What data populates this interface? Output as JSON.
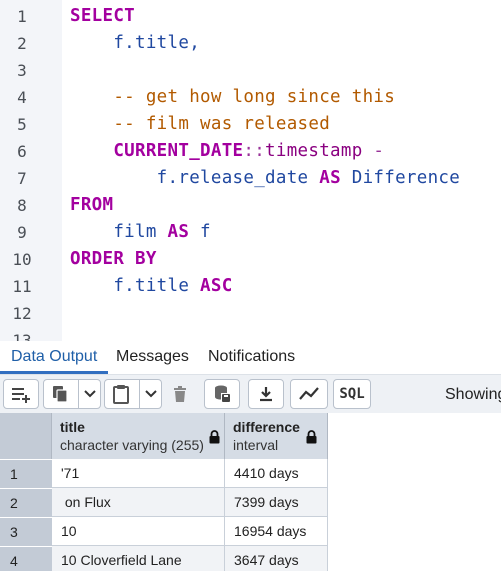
{
  "editor": {
    "lines": [
      {
        "n": "1",
        "tokens": [
          {
            "t": "SELECT",
            "c": "kw"
          }
        ]
      },
      {
        "n": "2",
        "tokens": [
          {
            "t": "    f.title,",
            "c": "id"
          }
        ]
      },
      {
        "n": "3",
        "tokens": []
      },
      {
        "n": "4",
        "tokens": [
          {
            "t": "    -- get how long since this",
            "c": "cm"
          }
        ]
      },
      {
        "n": "5",
        "tokens": [
          {
            "t": "    -- film was released",
            "c": "cm"
          }
        ]
      },
      {
        "n": "6",
        "tokens": [
          {
            "t": "    ",
            "c": "id"
          },
          {
            "t": "CURRENT_DATE",
            "c": "kw"
          },
          {
            "t": "::",
            "c": "op"
          },
          {
            "t": "timestamp",
            "c": "fn"
          },
          {
            "t": " -",
            "c": "op"
          }
        ]
      },
      {
        "n": "7",
        "tokens": [
          {
            "t": "        f.release_date ",
            "c": "id"
          },
          {
            "t": "AS",
            "c": "kw"
          },
          {
            "t": " Difference",
            "c": "id"
          }
        ]
      },
      {
        "n": "8",
        "tokens": [
          {
            "t": "FROM",
            "c": "kw"
          }
        ]
      },
      {
        "n": "9",
        "tokens": [
          {
            "t": "    film ",
            "c": "id"
          },
          {
            "t": "AS",
            "c": "kw"
          },
          {
            "t": " f",
            "c": "id"
          }
        ]
      },
      {
        "n": "10",
        "tokens": [
          {
            "t": "ORDER BY",
            "c": "kw"
          }
        ]
      },
      {
        "n": "11",
        "tokens": [
          {
            "t": "    f.title ",
            "c": "id"
          },
          {
            "t": "ASC",
            "c": "kw"
          }
        ]
      },
      {
        "n": "12",
        "tokens": []
      },
      {
        "n": "13",
        "tokens": []
      }
    ]
  },
  "tabs": {
    "data_output": "Data Output",
    "messages": "Messages",
    "notifications": "Notifications"
  },
  "toolbar": {
    "icons": [
      "add-row-icon",
      "copy-icon",
      "dropdown-chevron-icon",
      "paste-icon",
      "dropdown-chevron-icon",
      "delete-icon",
      "save-data-icon",
      "download-icon",
      "graph-visualiser-icon"
    ],
    "sql_label": "SQL",
    "showing_label": "Showing"
  },
  "grid": {
    "columns": [
      {
        "name": "title",
        "type": "character varying (255)"
      },
      {
        "name": "difference",
        "type": "interval"
      }
    ],
    "rows": [
      {
        "n": "1",
        "title": "'71",
        "difference": "4410 days"
      },
      {
        "n": "2",
        "title": " on Flux",
        "difference": "7399 days"
      },
      {
        "n": "3",
        "title": "10",
        "difference": "16954 days"
      },
      {
        "n": "4",
        "title": "10 Cloverfield Lane",
        "difference": "3647 days"
      }
    ]
  }
}
